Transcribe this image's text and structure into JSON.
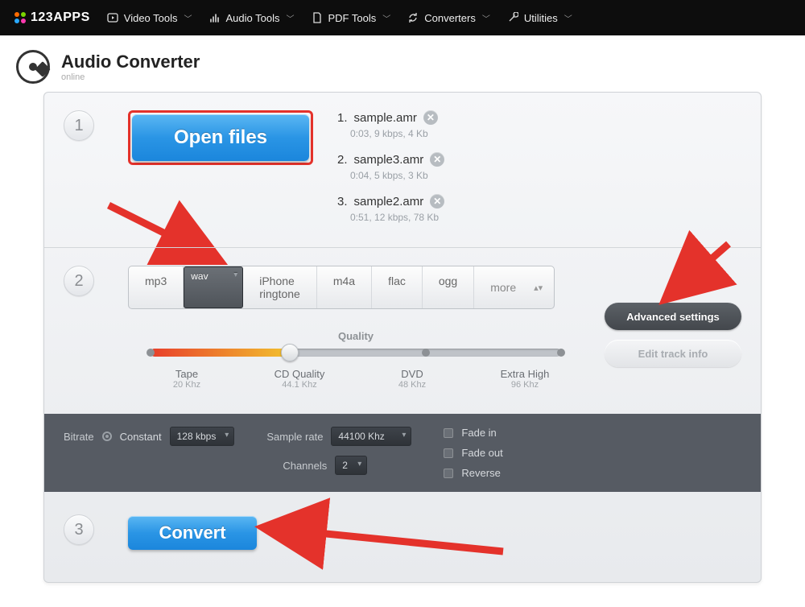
{
  "nav": {
    "brand": "123APPS",
    "items": [
      {
        "label": "Video Tools"
      },
      {
        "label": "Audio Tools"
      },
      {
        "label": "PDF Tools"
      },
      {
        "label": "Converters"
      },
      {
        "label": "Utilities"
      }
    ]
  },
  "page": {
    "title": "Audio Converter",
    "subtitle": "online"
  },
  "step1": {
    "open_label": "Open files",
    "files": [
      {
        "no": "1.",
        "name": "sample.amr",
        "meta": "0:03, 9 kbps, 4 Kb"
      },
      {
        "no": "2.",
        "name": "sample3.amr",
        "meta": "0:04, 5 kbps, 3 Kb"
      },
      {
        "no": "3.",
        "name": "sample2.amr",
        "meta": "0:51, 12 kbps, 78 Kb"
      }
    ]
  },
  "step2": {
    "formats": [
      "mp3",
      "wav",
      "iPhone ringtone",
      "m4a",
      "flac",
      "ogg",
      "more"
    ],
    "selected": "wav",
    "quality_title": "Quality",
    "qlabels": [
      {
        "t": "Tape",
        "s": "20 Khz"
      },
      {
        "t": "CD Quality",
        "s": "44.1 Khz"
      },
      {
        "t": "DVD",
        "s": "48 Khz"
      },
      {
        "t": "Extra High",
        "s": "96 Khz"
      }
    ],
    "advanced_btn": "Advanced settings",
    "editinfo_btn": "Edit track info"
  },
  "adv": {
    "bitrate_label": "Bitrate",
    "bitrate_mode": "Constant",
    "bitrate_value": "128 kbps",
    "samplerate_label": "Sample rate",
    "samplerate_value": "44100 Khz",
    "channels_label": "Channels",
    "channels_value": "2",
    "fadein": "Fade in",
    "fadeout": "Fade out",
    "reverse": "Reverse"
  },
  "step3": {
    "convert_label": "Convert"
  }
}
